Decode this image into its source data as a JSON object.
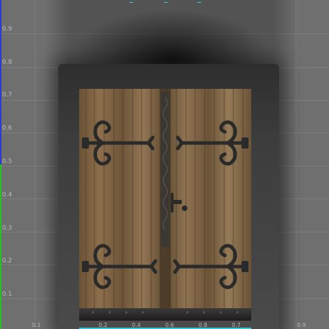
{
  "viewer": {
    "y_ticks": [
      "0.9",
      "0.8",
      "0.7",
      "0.6",
      "0.5",
      "0.4",
      "0.3",
      "0.2",
      "0.1"
    ],
    "x_ticks": [
      "0.1",
      "0.2",
      "0.4",
      "0.6",
      "0.8",
      "0.7",
      "0.9"
    ],
    "colors": {
      "background": "#6f6f6f",
      "grid": "#8a8a8a",
      "axis_lower": "#22c422",
      "axis_upper": "#2a3ad8",
      "marker": "#39c6d6"
    },
    "content": {
      "type": "photo",
      "subject": "wooden double doors with iron hinges"
    }
  }
}
